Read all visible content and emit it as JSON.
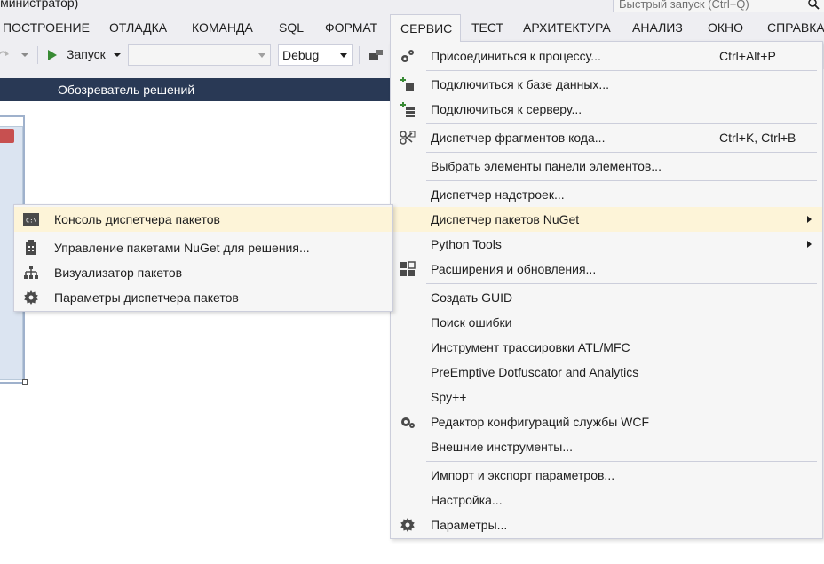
{
  "window": {
    "title_fragment": "дминистратор)"
  },
  "quick_launch": {
    "placeholder": "Быстрый запуск (Ctrl+Q)"
  },
  "menubar": {
    "items": [
      {
        "label": "ПОСТРОЕНИЕ",
        "open": false
      },
      {
        "label": "ОТЛАДКА",
        "open": false
      },
      {
        "label": "КОМАНДА",
        "open": false
      },
      {
        "label": "SQL",
        "open": false
      },
      {
        "label": "ФОРМАТ",
        "open": false
      },
      {
        "label": "СЕРВИС",
        "open": true
      },
      {
        "label": "ТЕСТ",
        "open": false
      },
      {
        "label": "АРХИТЕКТУРА",
        "open": false
      },
      {
        "label": "АНАЛИЗ",
        "open": false
      },
      {
        "label": "ОКНО",
        "open": false
      },
      {
        "label": "СПРАВКА",
        "open": false
      }
    ]
  },
  "toolbar": {
    "start_label": "Запуск",
    "target_combo_value": "",
    "config_combo_value": "Debug"
  },
  "solution_explorer": {
    "title": "Обозреватель решений"
  },
  "service_menu": {
    "items": [
      {
        "label": "Присоединиться к процессу...",
        "shortcut": "Ctrl+Alt+P",
        "icon": "attach-process-icon"
      },
      {
        "label": "Подключиться к базе данных...",
        "shortcut": "",
        "icon": "connect-database-icon"
      },
      {
        "label": "Подключиться к серверу...",
        "shortcut": "",
        "icon": "connect-server-icon"
      },
      {
        "label": "Диспетчер фрагментов кода...",
        "shortcut": "Ctrl+K, Ctrl+B",
        "icon": "snippets-icon"
      },
      {
        "label": "Выбрать элементы панели элементов...",
        "shortcut": "",
        "icon": ""
      },
      {
        "label": "Диспетчер надстроек...",
        "shortcut": "",
        "icon": ""
      },
      {
        "label": "Диспетчер пакетов NuGet",
        "shortcut": "",
        "icon": "",
        "submenu": true,
        "highlighted": true
      },
      {
        "label": "Python Tools",
        "shortcut": "",
        "icon": "",
        "submenu": true
      },
      {
        "label": "Расширения и обновления...",
        "shortcut": "",
        "icon": "extensions-icon"
      },
      {
        "label": "Создать GUID",
        "shortcut": "",
        "icon": ""
      },
      {
        "label": "Поиск ошибки",
        "shortcut": "",
        "icon": ""
      },
      {
        "label": "Инструмент трассировки ATL/MFC",
        "shortcut": "",
        "icon": ""
      },
      {
        "label": "PreEmptive Dotfuscator and Analytics",
        "shortcut": "",
        "icon": ""
      },
      {
        "label": "Spy++",
        "shortcut": "",
        "icon": ""
      },
      {
        "label": "Редактор конфигураций службы WCF",
        "shortcut": "",
        "icon": "wcf-config-icon"
      },
      {
        "label": "Внешние инструменты...",
        "shortcut": "",
        "icon": ""
      },
      {
        "label": "Импорт и экспорт параметров...",
        "shortcut": "",
        "icon": ""
      },
      {
        "label": "Настройка...",
        "shortcut": "",
        "icon": ""
      },
      {
        "label": "Параметры...",
        "shortcut": "",
        "icon": "gear-icon"
      }
    ]
  },
  "nuget_submenu": {
    "items": [
      {
        "label": "Консоль диспетчера пакетов",
        "icon": "console-icon",
        "highlighted": true
      },
      {
        "label": "Управление пакетами NuGet для решения...",
        "icon": "package-icon"
      },
      {
        "label": "Визуализатор пакетов",
        "icon": "hierarchy-icon"
      },
      {
        "label": "Параметры диспетчера пакетов",
        "icon": "gear-icon"
      }
    ]
  },
  "colors": {
    "chrome_bg": "#eeeef2",
    "menu_bg": "#f6f6f6",
    "menu_border": "#cccedb",
    "highlight": "#fdf4d8",
    "panel_header": "#293955",
    "start_green": "#388a34"
  }
}
